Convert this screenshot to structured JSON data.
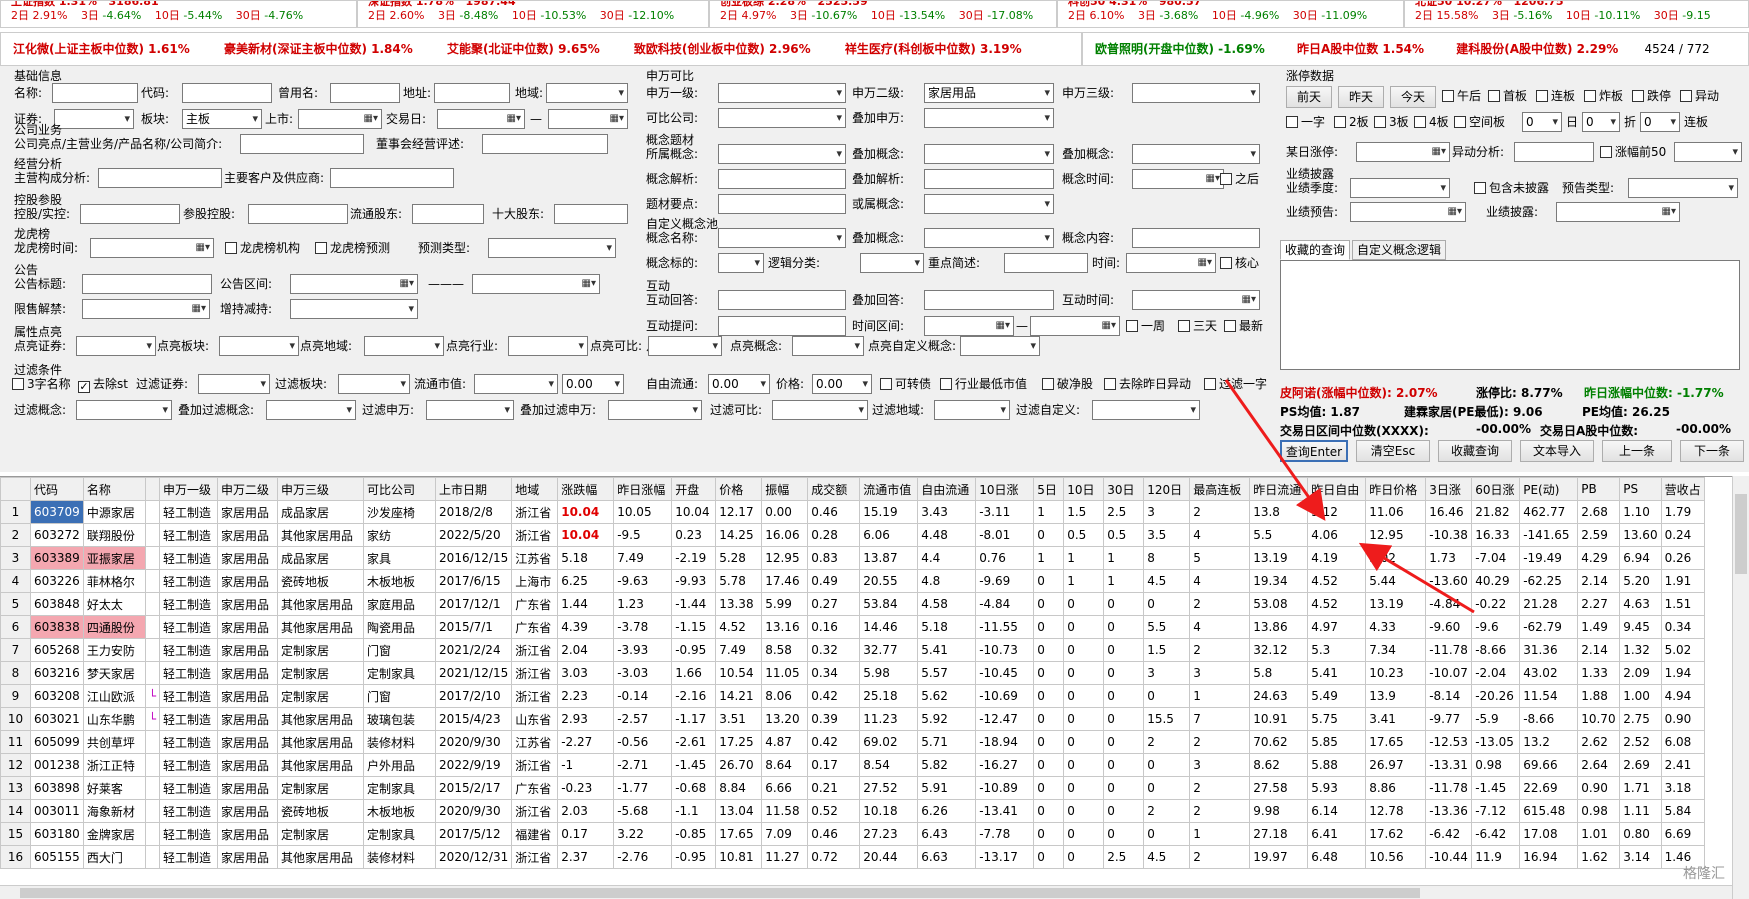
{
  "tickers": [
    {
      "name": "上证指数",
      "pct": "1.31%",
      "val": "3186.81",
      "d2": "2.91%",
      "d3": "-4.64%",
      "d10": "-5.44%",
      "d30": "-4.76%"
    },
    {
      "name": "深证指数",
      "pct": "1.78%",
      "val": "1987.44",
      "d2": "2.60%",
      "d3": "-8.48%",
      "d10": "-10.53%",
      "d30": "-12.10%"
    },
    {
      "name": "创业板综",
      "pct": "2.28%",
      "val": "2525.59",
      "d2": "4.97%",
      "d3": "-10.67%",
      "d10": "-13.54%",
      "d30": "-17.08%"
    },
    {
      "name": "科创50",
      "pct": "4.31%",
      "val": "980.57",
      "d2": "6.10%",
      "d3": "-3.68%",
      "d10": "-4.96%",
      "d30": "-11.09%"
    },
    {
      "name": "北证50",
      "pct": "10.27%",
      "val": "1206.75",
      "d2": "15.58%",
      "d3": "-5.16%",
      "d10": "-10.11%",
      "d30": "-9.15"
    }
  ],
  "ticker_labels": {
    "d2": "2日",
    "d3": "3日",
    "d10": "10日",
    "d30": "30日"
  },
  "band_red": [
    "江化微(上证主板中位数) 1.61%",
    "豪美新材(深证主板中位数) 1.84%",
    "艾能聚(北证中位数) 9.65%",
    "致欧科技(创业板中位数) 2.96%",
    "祥生医疗(科创板中位数) 3.19%"
  ],
  "band_right": {
    "a": "欧普照明(开盘中位数) -1.69%",
    "b": "昨日A股中位数 1.54%",
    "c": "建科股份(A股中位数) 2.29%",
    "count": "4524 / 772"
  },
  "basic": {
    "title": "基础信息",
    "name": "名称:",
    "code": "代码:",
    "former": "曾用名:",
    "addr": "地址:",
    "region": "地域:",
    "sec": "证券:",
    "board": "板块:",
    "board_val": "主板",
    "listing": "上市:",
    "trade": "交易日:",
    "dash": "—"
  },
  "biz": {
    "title": "公司业务",
    "highlight": "公司亮点/主营业务/产品名称/公司简介:",
    "board_rev": "董事会经营评述:"
  },
  "op": {
    "title": "经营分析",
    "comp": "主营构成分析:",
    "cust": "主要客户及供应商:"
  },
  "hold": {
    "title": "控股参股",
    "ctrl": "控股/实控:",
    "part": "参股控股:",
    "float": "流通股东:",
    "top10": "十大股东:"
  },
  "dragon": {
    "title": "龙虎榜",
    "time": "龙虎榜时间:",
    "inst": "龙虎榜机构",
    "pred": "龙虎榜预测",
    "ptype": "预测类型:"
  },
  "notice": {
    "title": "公告",
    "ntitle": "公告标题:",
    "range": "公告区间:",
    "sep": "———",
    "unlock": "限售解禁:",
    "incr": "增持减持:"
  },
  "attr": {
    "title": "属性点亮",
    "sec": "点亮证券:",
    "board": "点亮板块:",
    "region": "点亮地域:",
    "ind": "点亮行业:",
    "comp": "点亮可比:",
    "concept": "点亮概念:",
    "custom": "点亮自定义概念:"
  },
  "filter": {
    "title": "过滤条件",
    "n3": "3字名称",
    "st": "去除st",
    "fsec": "过滤证券:",
    "fboard": "过滤板块:",
    "mcap": "流通市值:",
    "mcap_val": "0.00",
    "free": "自由流通:",
    "free_val": "0.00",
    "price": "价格:",
    "price_val": "0.00",
    "conv": "可转债",
    "indmin": "行业最低市值",
    "bnet": "破净股",
    "rmabn": "去除昨日异动",
    "fone": "过滤一字",
    "fconcept": "过滤概念:",
    "afconcept": "叠加过滤概念:",
    "fsw": "过滤申万:",
    "afsw": "叠加过滤申万:",
    "fcomp": "过滤可比:",
    "fregion": "过滤地域:",
    "fcustom": "过滤自定义:"
  },
  "sw": {
    "title": "申万可比",
    "l1": "申万一级:",
    "l2": "申万二级:",
    "l2_val": "家居用品",
    "l3": "申万三级:",
    "comp": "可比公司:",
    "add": "叠加申万:"
  },
  "theme": {
    "title": "概念题材",
    "owned": "所属概念:",
    "addc": "叠加概念:",
    "addc2": "叠加概念:",
    "parse": "概念解析:",
    "addparse": "叠加解析:",
    "ctime": "概念时间:",
    "after": "之后",
    "points": "题材要点:",
    "orc": "或属概念:"
  },
  "cpool": {
    "title": "自定义概念池",
    "cname": "概念名称:",
    "addc": "叠加概念:",
    "content": "概念内容:",
    "target": "概念标的:",
    "logic": "逻辑分类:",
    "key": "重点简述:",
    "time": "时间:",
    "core": "核心"
  },
  "inter": {
    "title": "互动",
    "ans": "互动回答:",
    "addans": "叠加回答:",
    "itime": "互动时间:",
    "ask": "互动提问:",
    "range": "时间区间:",
    "w1": "一周",
    "d3": "三天",
    "latest": "最新"
  },
  "limit": {
    "title": "涨停数据",
    "prev": "前天",
    "yest": "昨天",
    "today": "今天",
    "pm": "午后",
    "first": "首板",
    "cont": "连板",
    "burst": "炸板",
    "drop": "跌停",
    "abn": "异动",
    "one": "一字",
    "b2": "2板",
    "b3": "3板",
    "b4": "4板",
    "gap": "空间板",
    "v0": "0",
    "day": "日",
    "v1": "0",
    "fold": "折",
    "v2": "0",
    "lian": "连板",
    "someday": "某日涨停:",
    "abnana": "异动分析:",
    "top50": "涨幅前50"
  },
  "perf": {
    "title": "业绩披露",
    "season": "业绩季度:",
    "undisc": "包含未披露",
    "ftype": "预告类型:",
    "fore": "业绩预告:",
    "disc": "业绩披露:"
  },
  "tabs": {
    "fav": "收藏的查询",
    "logic": "自定义概念逻辑"
  },
  "stats": {
    "s1": "皮阿诺(涨幅中位数): 2.07%",
    "s2": "涨停比: 8.77%",
    "s3": "昨日涨幅中位数: -1.77%",
    "s4": "PS均值: 1.87",
    "s5": "建霖家居(PE最低): 9.06",
    "s6": "PE均值: 26.25",
    "s7": "交易日区间中位数(XXXX):",
    "s8": "-00.00%",
    "s9": "交易日A股中位数:",
    "s10": "-00.00%"
  },
  "actions": {
    "query": "查询Enter",
    "clear": "清空Esc",
    "fav": "收藏查询",
    "import": "文本导入",
    "prev": "上一条",
    "next": "下一条"
  },
  "table": {
    "headers": [
      "",
      "代码",
      "名称",
      "",
      "申万一级",
      "申万二级",
      "申万三级",
      "可比公司",
      "上市日期",
      "地域",
      "涨跌幅",
      "昨日涨幅",
      "开盘",
      "价格",
      "振幅",
      "成交额",
      "流通市值",
      "自由流通",
      "10日涨",
      "5日",
      "10日",
      "30日",
      "120日",
      "最高连板",
      "昨日流通",
      "昨日自由",
      "昨日价格",
      "3日涨",
      "60日涨",
      "PE(动)",
      "PB",
      "PS",
      "营收占"
    ],
    "rows": [
      [
        "1",
        "603709",
        "中源家居",
        "",
        "轻工制造",
        "家居用品",
        "成品家居",
        "沙发座椅",
        "2018/2/8",
        "浙江省",
        "10.04",
        "10.05",
        "10.04",
        "12.17",
        "0.00",
        "0.46",
        "15.19",
        "3.43",
        "-3.11",
        "1",
        "1.5",
        "2.5",
        "3",
        "2",
        "13.8",
        "3.12",
        "11.06",
        "16.46",
        "21.82",
        "462.77",
        "2.68",
        "1.10",
        "1.79"
      ],
      [
        "2",
        "603272",
        "联翔股份",
        "",
        "轻工制造",
        "家居用品",
        "其他家居用品",
        "家纺",
        "2022/5/20",
        "浙江省",
        "10.04",
        "-9.5",
        "0.23",
        "14.25",
        "16.06",
        "0.28",
        "6.06",
        "4.48",
        "-8.01",
        "0",
        "0.5",
        "0.5",
        "3.5",
        "4",
        "5.5",
        "4.06",
        "12.95",
        "-10.38",
        "16.33",
        "-141.65",
        "2.59",
        "13.60",
        "0.24"
      ],
      [
        "3",
        "603389",
        "亚振家居",
        "",
        "轻工制造",
        "家居用品",
        "成品家居",
        "家具",
        "2016/12/15",
        "江苏省",
        "5.18",
        "7.49",
        "-2.19",
        "5.28",
        "12.95",
        "0.83",
        "13.87",
        "4.4",
        "0.76",
        "1",
        "1",
        "1",
        "8",
        "5",
        "13.19",
        "4.19",
        "5.02",
        "1.73",
        "-7.04",
        "-19.49",
        "4.29",
        "6.94",
        "0.26"
      ],
      [
        "4",
        "603226",
        "菲林格尔",
        "",
        "轻工制造",
        "家居用品",
        "瓷砖地板",
        "木板地板",
        "2017/6/15",
        "上海市",
        "6.25",
        "-9.63",
        "-9.93",
        "5.78",
        "17.46",
        "0.49",
        "20.55",
        "4.8",
        "-9.69",
        "0",
        "1",
        "1",
        "4.5",
        "4",
        "19.34",
        "4.52",
        "5.44",
        "-13.60",
        "40.29",
        "-62.25",
        "2.14",
        "5.20",
        "1.91"
      ],
      [
        "5",
        "603848",
        "好太太",
        "",
        "轻工制造",
        "家居用品",
        "其他家居用品",
        "家庭用品",
        "2017/12/1",
        "广东省",
        "1.44",
        "1.23",
        "-1.44",
        "13.38",
        "5.99",
        "0.27",
        "53.84",
        "4.58",
        "-4.84",
        "0",
        "0",
        "0",
        "0",
        "2",
        "53.08",
        "4.52",
        "13.19",
        "-4.84",
        "-0.22",
        "21.28",
        "2.27",
        "4.63",
        "1.51"
      ],
      [
        "6",
        "603838",
        "四通股份",
        "",
        "轻工制造",
        "家居用品",
        "其他家居用品",
        "陶瓷用品",
        "2015/7/1",
        "广东省",
        "4.39",
        "-3.78",
        "-1.15",
        "4.52",
        "13.16",
        "0.16",
        "14.46",
        "5.18",
        "-11.55",
        "0",
        "0",
        "0",
        "5.5",
        "4",
        "13.86",
        "4.97",
        "4.33",
        "-9.60",
        "-9.6",
        "-62.79",
        "1.49",
        "9.45",
        "0.34"
      ],
      [
        "7",
        "605268",
        "王力安防",
        "",
        "轻工制造",
        "家居用品",
        "定制家居",
        "门窗",
        "2021/2/24",
        "浙江省",
        "2.04",
        "-3.93",
        "-0.95",
        "7.49",
        "8.58",
        "0.32",
        "32.77",
        "5.41",
        "-10.73",
        "0",
        "0",
        "0",
        "1.5",
        "2",
        "32.12",
        "5.3",
        "7.34",
        "-11.78",
        "-8.66",
        "31.36",
        "2.14",
        "1.32",
        "5.02"
      ],
      [
        "8",
        "603216",
        "梦天家居",
        "",
        "轻工制造",
        "家居用品",
        "定制家居",
        "定制家具",
        "2021/12/15",
        "浙江省",
        "3.03",
        "-3.03",
        "1.66",
        "10.54",
        "11.05",
        "0.34",
        "5.98",
        "5.57",
        "-10.45",
        "0",
        "0",
        "0",
        "3",
        "3",
        "5.8",
        "5.41",
        "10.23",
        "-10.07",
        "-2.04",
        "43.02",
        "1.33",
        "2.09",
        "1.94"
      ],
      [
        "9",
        "603208",
        "江山欧派",
        "",
        "轻工制造",
        "家居用品",
        "定制家居",
        "门窗",
        "2017/2/10",
        "浙江省",
        "2.23",
        "-0.14",
        "-2.16",
        "14.21",
        "8.06",
        "0.42",
        "25.18",
        "5.62",
        "-10.69",
        "0",
        "0",
        "0",
        "0",
        "1",
        "24.63",
        "5.49",
        "13.9",
        "-8.14",
        "-20.26",
        "11.54",
        "1.88",
        "1.00",
        "4.94"
      ],
      [
        "10",
        "603021",
        "山东华鹏",
        "",
        "轻工制造",
        "家居用品",
        "其他家居用品",
        "玻璃包装",
        "2015/4/23",
        "山东省",
        "2.93",
        "-2.57",
        "-1.17",
        "3.51",
        "13.20",
        "0.39",
        "11.23",
        "5.92",
        "-12.47",
        "0",
        "0",
        "0",
        "15.5",
        "7",
        "10.91",
        "5.75",
        "3.41",
        "-9.77",
        "-5.9",
        "-8.66",
        "10.70",
        "2.75",
        "0.90"
      ],
      [
        "11",
        "605099",
        "共创草坪",
        "",
        "轻工制造",
        "家居用品",
        "其他家居用品",
        "装修材料",
        "2020/9/30",
        "江苏省",
        "-2.27",
        "-0.56",
        "-2.61",
        "17.25",
        "4.87",
        "0.42",
        "69.02",
        "5.71",
        "-18.94",
        "0",
        "0",
        "0",
        "2",
        "2",
        "70.62",
        "5.85",
        "17.65",
        "-12.53",
        "-13.05",
        "13.2",
        "2.62",
        "2.52",
        "6.08"
      ],
      [
        "12",
        "001238",
        "浙江正特",
        "",
        "轻工制造",
        "家居用品",
        "其他家居用品",
        "户外用品",
        "2022/9/19",
        "浙江省",
        "-1",
        "-2.71",
        "-1.45",
        "26.70",
        "8.64",
        "0.17",
        "8.54",
        "5.82",
        "-16.27",
        "0",
        "0",
        "0",
        "0",
        "3",
        "8.62",
        "5.88",
        "26.97",
        "-13.31",
        "0.98",
        "69.66",
        "2.64",
        "2.69",
        "2.41"
      ],
      [
        "13",
        "603898",
        "好莱客",
        "",
        "轻工制造",
        "家居用品",
        "定制家居",
        "定制家具",
        "2015/2/17",
        "广东省",
        "-0.23",
        "-1.77",
        "-0.68",
        "8.84",
        "6.66",
        "0.21",
        "27.52",
        "5.91",
        "-10.89",
        "0",
        "0",
        "0",
        "0",
        "2",
        "27.58",
        "5.93",
        "8.86",
        "-11.78",
        "-1.45",
        "22.69",
        "0.90",
        "1.71",
        "3.18"
      ],
      [
        "14",
        "003011",
        "海象新材",
        "",
        "轻工制造",
        "家居用品",
        "瓷砖地板",
        "木板地板",
        "2020/9/30",
        "浙江省",
        "2.03",
        "-5.68",
        "-1.1",
        "13.04",
        "11.58",
        "0.52",
        "10.18",
        "6.26",
        "-13.41",
        "0",
        "0",
        "0",
        "2",
        "2",
        "9.98",
        "6.14",
        "12.78",
        "-13.36",
        "-7.12",
        "615.48",
        "0.98",
        "1.11",
        "5.84"
      ],
      [
        "15",
        "603180",
        "金牌家居",
        "",
        "轻工制造",
        "家居用品",
        "定制家居",
        "定制家具",
        "2017/5/12",
        "福建省",
        "0.17",
        "3.22",
        "-0.85",
        "17.65",
        "7.09",
        "0.46",
        "27.23",
        "6.43",
        "-7.78",
        "0",
        "0",
        "0",
        "0",
        "1",
        "27.18",
        "6.41",
        "17.62",
        "-6.42",
        "-6.42",
        "17.08",
        "1.01",
        "0.80",
        "6.69"
      ],
      [
        "16",
        "605155",
        "西大门",
        "",
        "轻工制造",
        "家居用品",
        "其他家居用品",
        "装修材料",
        "2020/12/31",
        "浙江省",
        "2.37",
        "-2.76",
        "-0.95",
        "10.81",
        "11.27",
        "0.72",
        "20.44",
        "6.63",
        "-13.17",
        "0",
        "0",
        "2.5",
        "4.5",
        "2",
        "19.97",
        "6.48",
        "10.56",
        "-10.44",
        "11.9",
        "16.94",
        "1.62",
        "3.14",
        "1.46"
      ]
    ]
  },
  "colors": {
    "red": "#d00000",
    "green": "#008000",
    "highlight": "#f4a7b0",
    "arrow": "#ee1c1c",
    "panel": "#f0f0f0"
  },
  "watermark": "格隆汇"
}
